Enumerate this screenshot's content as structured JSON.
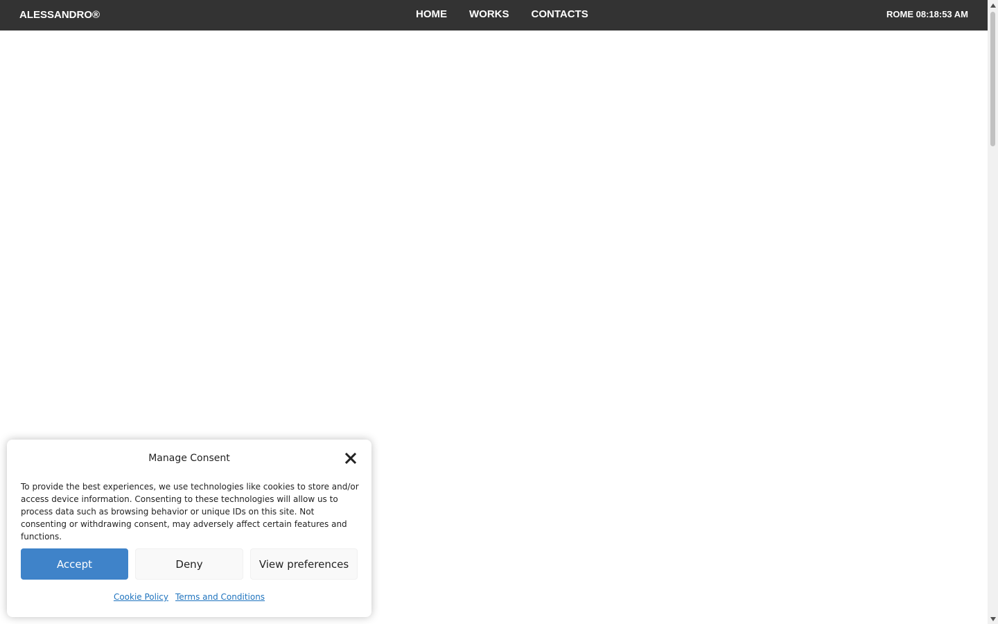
{
  "header": {
    "brand": "ALESSANDRO®",
    "nav": [
      {
        "label": "HOME"
      },
      {
        "label": "WORKS"
      },
      {
        "label": "CONTACTS"
      }
    ],
    "clock": "ROME 08:18:53 AM"
  },
  "consent": {
    "title": "Manage Consent",
    "body": "To provide the best experiences, we use technologies like cookies to store and/or access device information. Consenting to these technologies will allow us to process data such as browsing behavior or unique IDs on this site. Not consenting or withdrawing consent, may adversely affect certain features and functions.",
    "accept_label": "Accept",
    "deny_label": "Deny",
    "preferences_label": "View preferences",
    "links": [
      {
        "label": "Cookie Policy"
      },
      {
        "label": "Terms and Conditions"
      }
    ]
  },
  "icons": {
    "close": "close-icon",
    "scroll_up": "arrow-up-icon",
    "scroll_down": "arrow-down-icon"
  },
  "colors": {
    "header_bg": "#333333",
    "accent": "#3f83c9",
    "link": "#1e73be"
  }
}
